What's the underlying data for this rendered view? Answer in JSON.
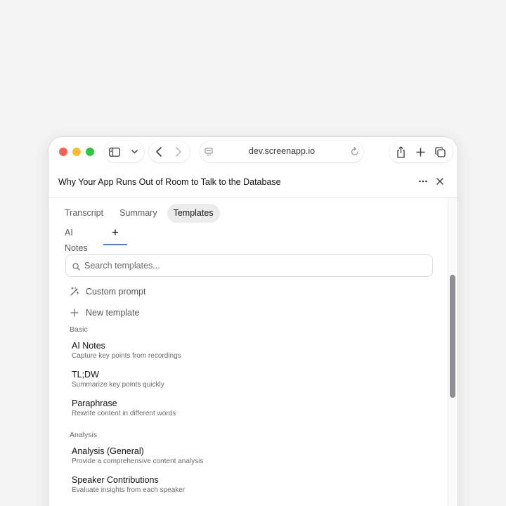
{
  "browser": {
    "url": "dev.screenapp.io"
  },
  "header": {
    "title": "Why Your App Runs Out of Room to Talk to the Database"
  },
  "tabs": [
    {
      "label": "Transcript"
    },
    {
      "label": "Summary"
    },
    {
      "label": "Templates"
    }
  ],
  "subtabs": {
    "ai_notes": "AI Notes",
    "plus": "+"
  },
  "search": {
    "placeholder": "Search templates..."
  },
  "actions": {
    "custom_prompt": "Custom prompt",
    "new_template": "New template"
  },
  "sections": {
    "basic": {
      "label": "Basic",
      "items": [
        {
          "title": "AI Notes",
          "desc": "Capture key points from recordings"
        },
        {
          "title": "TL;DW",
          "desc": "Summarize key points quickly"
        },
        {
          "title": "Paraphrase",
          "desc": "Rewrite content in different words"
        }
      ]
    },
    "analysis": {
      "label": "Analysis",
      "items": [
        {
          "title": "Analysis (General)",
          "desc": "Provide a comprehensive content analysis"
        },
        {
          "title": "Speaker Contributions",
          "desc": "Evaluate insights from each speaker"
        }
      ]
    }
  },
  "icons": {
    "traffic_lights": [
      "#fe5f57",
      "#febc2e",
      "#28c840"
    ],
    "accent": "#3b82f6"
  }
}
